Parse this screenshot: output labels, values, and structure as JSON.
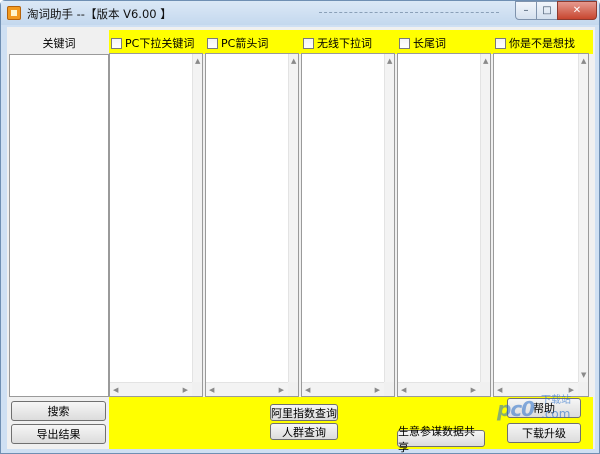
{
  "window": {
    "title": "淘词助手 --【版本 V6.00 】"
  },
  "caption": {
    "min": "–",
    "max": "□",
    "close": "✕"
  },
  "keyword_column": {
    "header": "关键词"
  },
  "columns": [
    {
      "label": "PC下拉关键词"
    },
    {
      "label": "PC箭头词"
    },
    {
      "label": "无线下拉词"
    },
    {
      "label": "长尾词"
    },
    {
      "label": "你是不是想找"
    }
  ],
  "buttons": {
    "search": "搜索",
    "export": "导出结果",
    "ali_index": "阿里指数查询",
    "crowd_query": "人群查询",
    "business_share": "生意参谋数据共享",
    "help": "帮助",
    "upgrade": "下载升级"
  },
  "watermark": {
    "logo": "pc0",
    "text": "下载站",
    "domain": ".com"
  },
  "colors": {
    "highlight": "#ffff00",
    "title_bg": "#cfe0f3",
    "close_btn": "#c7462f"
  }
}
